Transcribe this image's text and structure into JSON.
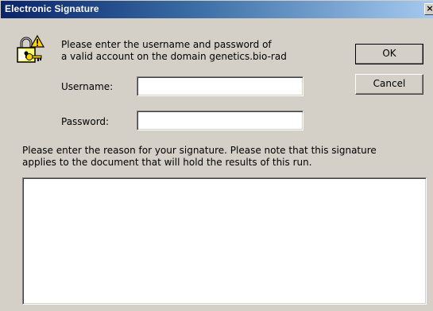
{
  "window": {
    "title": "Electronic Signature",
    "close_glyph": "×"
  },
  "prompt": {
    "line1": "Please enter the username and password of",
    "line2": "a valid account on the domain  genetics.bio-rad",
    "icon": "lock-key-warning-icon"
  },
  "form": {
    "username_label": "Username:",
    "username_value": "",
    "password_label": "Password:",
    "password_value": ""
  },
  "buttons": {
    "ok_label": "OK",
    "cancel_label": "Cancel"
  },
  "reason": {
    "line1": "Please enter the reason for your signature.  Please note that this signature",
    "line2": "applies to the document that will hold the results of this run.",
    "value": ""
  },
  "colors": {
    "titlebar_start": "#0a246a",
    "titlebar_end": "#a6caf0",
    "dialog_face": "#d4d0c8"
  }
}
